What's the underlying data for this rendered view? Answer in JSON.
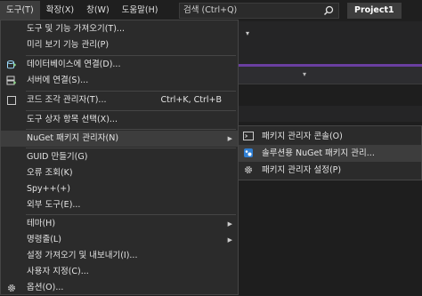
{
  "menubar": {
    "items": [
      {
        "label": "도구(T)",
        "active": true
      },
      {
        "label": "확장(X)",
        "active": false
      },
      {
        "label": "창(W)",
        "active": false
      },
      {
        "label": "도움말(H)",
        "active": false
      }
    ],
    "search_text": "검색 (Ctrl+Q)",
    "project_label": "Project1"
  },
  "tools_menu": {
    "items": [
      {
        "label": "도구 및 기능 가져오기(T)...",
        "icon": "none"
      },
      {
        "label": "미리 보기 기능 관리(P)",
        "icon": "none"
      },
      {
        "label": "데이터베이스에 연결(D)...",
        "icon": "database-connect-icon"
      },
      {
        "label": "서버에 연결(S)...",
        "icon": "server-connect-icon"
      },
      {
        "label": "코드 조각 관리자(T)...",
        "icon": "checkbox-icon",
        "shortcut": "Ctrl+K, Ctrl+B"
      },
      {
        "label": "도구 상자 항목 선택(X)...",
        "icon": "none"
      },
      {
        "label": "NuGet 패키지 관리자(N)",
        "icon": "none",
        "submenu": true
      },
      {
        "label": "GUID 만들기(G)",
        "icon": "none"
      },
      {
        "label": "오류 조회(K)",
        "icon": "none"
      },
      {
        "label": "Spy++(+)",
        "icon": "none"
      },
      {
        "label": "외부 도구(E)...",
        "icon": "none"
      },
      {
        "label": "테마(H)",
        "icon": "none",
        "submenu": true
      },
      {
        "label": "명령줄(L)",
        "icon": "none",
        "submenu": true
      },
      {
        "label": "설정 가져오기 및 내보내기(I)...",
        "icon": "none"
      },
      {
        "label": "사용자 지정(C)...",
        "icon": "none"
      },
      {
        "label": "옵션(O)...",
        "icon": "gear-icon"
      }
    ]
  },
  "nuget_submenu": {
    "items": [
      {
        "label": "패키지 관리자 콘솔(O)",
        "icon": "console-icon"
      },
      {
        "label": "솔루션용 NuGet 패키지 관리...",
        "icon": "nuget-icon"
      },
      {
        "label": "패키지 관리자 설정(P)",
        "icon": "gear-icon"
      }
    ]
  },
  "colors": {
    "accent": "#6a3fa0",
    "menu_bg": "#2b2b2b",
    "highlight": "#3d3d3d",
    "nuget_blue": "#2f7fd4"
  }
}
